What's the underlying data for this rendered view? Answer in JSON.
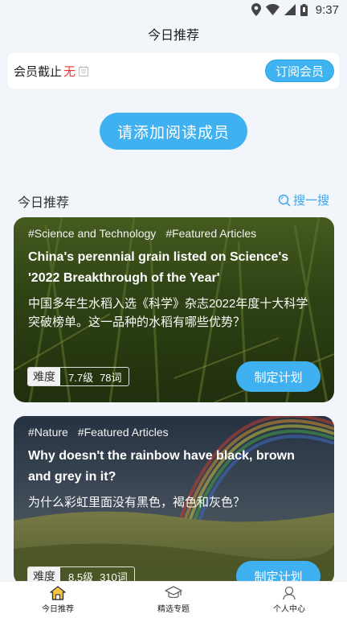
{
  "status_bar": {
    "time": "9:37"
  },
  "header": {
    "title": "今日推荐"
  },
  "member": {
    "label": "会员截止",
    "status": "无",
    "subscribe_label": "订阅会员"
  },
  "add_member_label": "请添加阅读成员",
  "section": {
    "title": "今日推荐",
    "search_label": "搜一搜"
  },
  "articles": [
    {
      "tags": [
        "#Science and Technology",
        "#Featured Articles"
      ],
      "title_en": "China's perennial grain listed on Science's '2022 Breakthrough of the Year'",
      "title_zh": "中国多年生水稻入选《科学》杂志2022年度十大科学突破榜单。这一品种的水稻有哪些优势？",
      "difficulty_label": "难度",
      "level": "7.7级",
      "words": "78词",
      "plan_label": "制定计划"
    },
    {
      "tags": [
        "#Nature",
        "#Featured Articles"
      ],
      "title_en": "Why doesn't the rainbow have black, brown and grey in it?",
      "title_zh": "为什么彩虹里面没有黑色，褐色和灰色？",
      "difficulty_label": "难度",
      "level": "8.5级",
      "words": "310词",
      "plan_label": "制定计划"
    }
  ],
  "bottom_nav": {
    "items": [
      {
        "label": "今日推荐",
        "icon": "home-icon"
      },
      {
        "label": "精选专题",
        "icon": "graduation-cap-icon"
      },
      {
        "label": "个人中心",
        "icon": "person-icon"
      }
    ]
  },
  "colors": {
    "accent": "#3fb1f0",
    "status_red": "#ee3333",
    "background": "#f2f5fa"
  }
}
